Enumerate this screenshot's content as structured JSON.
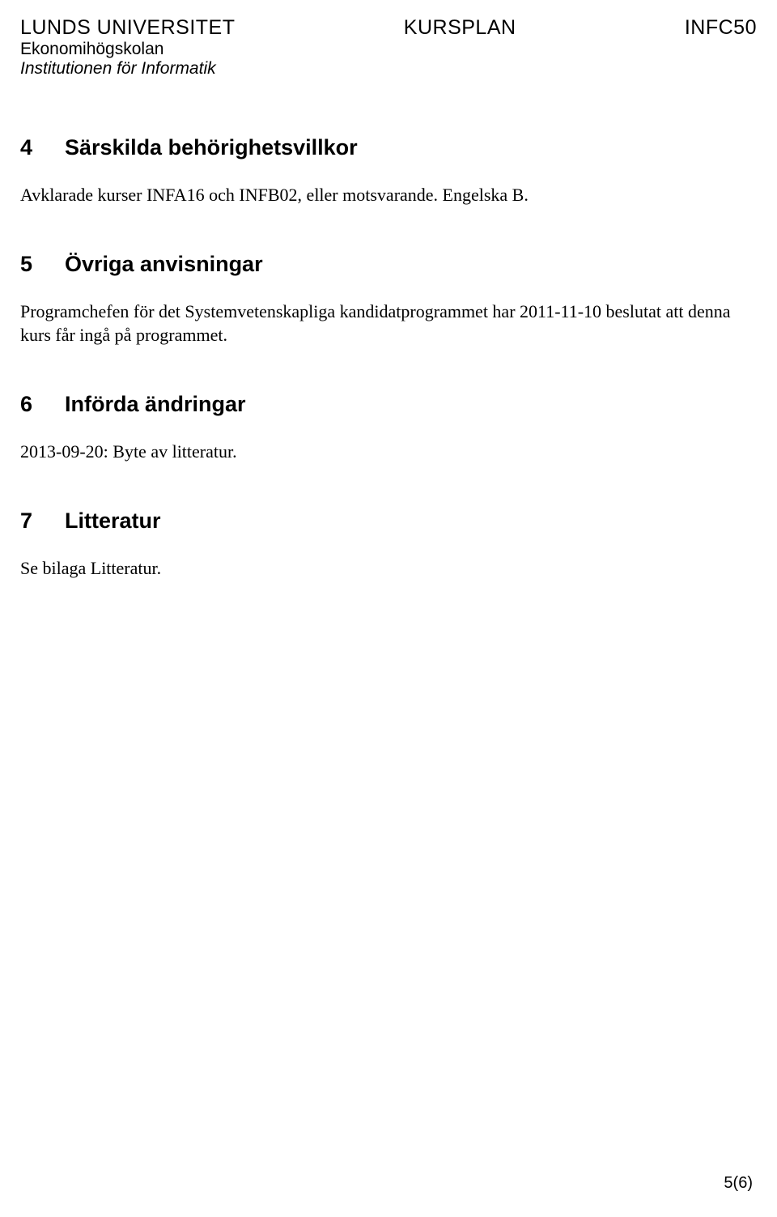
{
  "header": {
    "university": "LUNDS UNIVERSITET",
    "center": "KURSPLAN",
    "code": "INFC50",
    "school": "Ekonomihögskolan",
    "department": "Institutionen för Informatik"
  },
  "sections": [
    {
      "number": "4",
      "title": "Särskilda behörighetsvillkor",
      "body": "Avklarade kurser INFA16 och INFB02, eller motsvarande. Engelska B."
    },
    {
      "number": "5",
      "title": "Övriga anvisningar",
      "body": "Programchefen för det Systemvetenskapliga kandidatprogrammet har 2011-11-10 beslutat att denna kurs får ingå på programmet."
    },
    {
      "number": "6",
      "title": "Införda ändringar",
      "body": "2013-09-20: Byte av litteratur."
    },
    {
      "number": "7",
      "title": "Litteratur",
      "body": "Se bilaga Litteratur."
    }
  ],
  "page_number": "5(6)"
}
